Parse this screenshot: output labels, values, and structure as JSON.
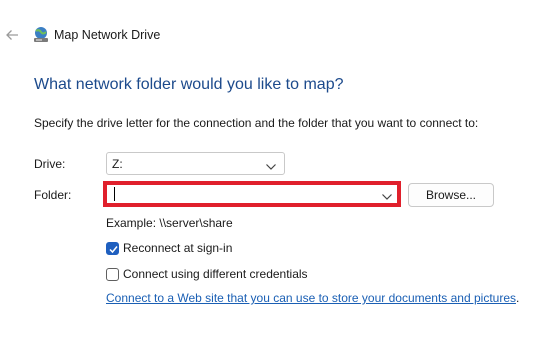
{
  "header": {
    "title": "Map Network Drive",
    "back_icon": "back-arrow-icon",
    "app_icon": "network-drive-icon"
  },
  "main": {
    "heading": "What network folder would you like to map?",
    "instruction": "Specify the drive letter for the connection and the folder that you want to connect to:",
    "drive": {
      "label": "Drive:",
      "value": "Z:"
    },
    "folder": {
      "label": "Folder:",
      "value": "",
      "highlight_color": "#e0202c"
    },
    "browse_label": "Browse...",
    "example": "Example: \\\\server\\share",
    "reconnect": {
      "label": "Reconnect at sign-in",
      "checked": true
    },
    "credentials": {
      "label": "Connect using different credentials",
      "checked": false
    },
    "link": {
      "text": "Connect to a Web site that you can use to store your documents and pictures",
      "suffix": "."
    }
  },
  "colors": {
    "accent": "#1f5fbf",
    "heading": "#1c4a8c",
    "link": "#1a5fb4"
  }
}
